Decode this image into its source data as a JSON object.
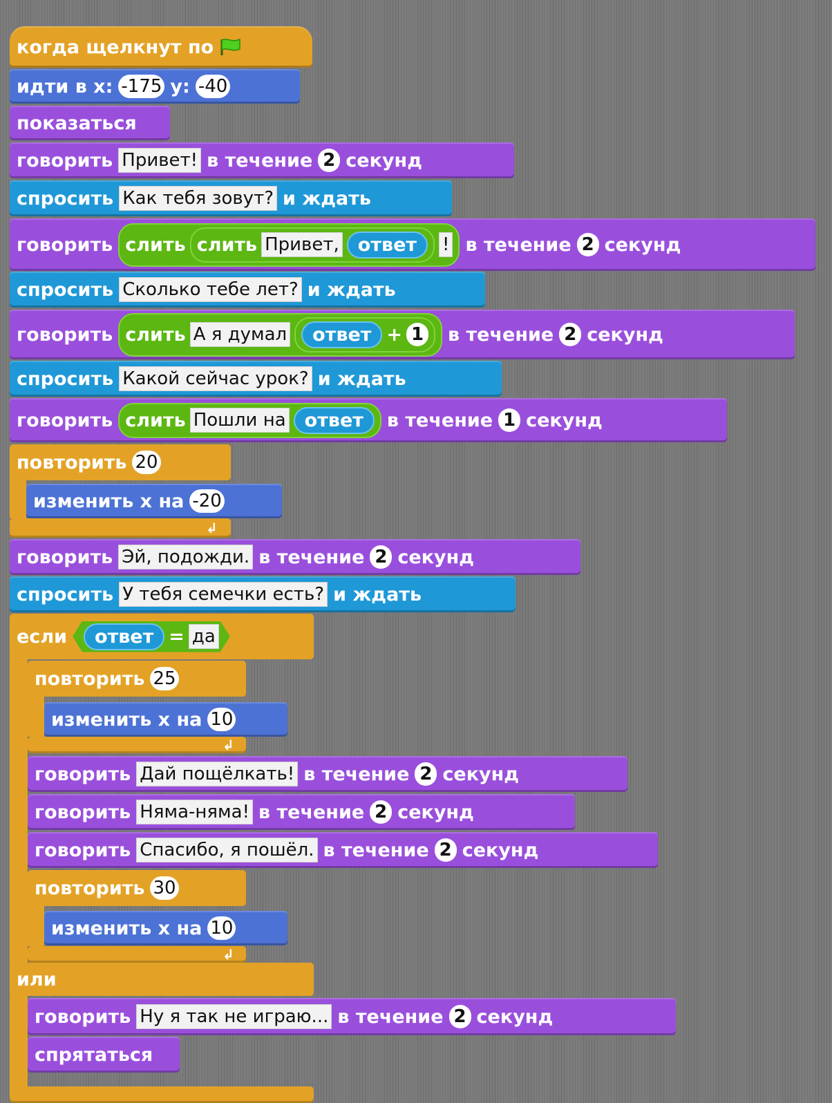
{
  "script": {
    "hat": {
      "label": "когда щелкнут по",
      "icon": "green-flag-icon"
    },
    "goto": {
      "label_x": "идти в x:",
      "x": "-175",
      "label_y": "y:",
      "y": "-40"
    },
    "show": "показаться",
    "say_label": "говорить",
    "ask_label": "спросить",
    "wait_label": "и ждать",
    "for_label": "в течение",
    "secs_label": "секунд",
    "join_label": "слить",
    "answer_label": "ответ",
    "plus": "+",
    "equals": "=",
    "repeat_label": "повторить",
    "change_x_label": "изменить x на",
    "if_label": "если",
    "else_label": "или",
    "hide": "спрятаться",
    "say1": {
      "text": "Привет!",
      "secs": "2"
    },
    "ask1": "Как тебя зовут?",
    "say2": {
      "t1": "Привет,",
      "t2": "!",
      "secs": "2"
    },
    "ask2": "Сколько тебе лет?",
    "say3": {
      "t1": "А я думал",
      "n": "1",
      "secs": "2"
    },
    "ask3": "Какой сейчас урок?",
    "say4": {
      "t1": "Пошли на",
      "secs": "1"
    },
    "repeat1": {
      "count": "20",
      "change": "-20"
    },
    "say5": {
      "text": "Эй, подожди.",
      "secs": "2"
    },
    "ask4": "У тебя семечки есть?",
    "if_value": "да",
    "repeat2": {
      "count": "25",
      "change": "10"
    },
    "say6": {
      "text": "Дай пощёлкать!",
      "secs": "2"
    },
    "say7": {
      "text": "Няма-няма!",
      "secs": "2"
    },
    "say8": {
      "text": "Спасибо, я пошёл.",
      "secs": "2"
    },
    "repeat3": {
      "count": "30",
      "change": "10"
    },
    "say9": {
      "text": "Ну я так не играю...",
      "secs": "2"
    }
  }
}
